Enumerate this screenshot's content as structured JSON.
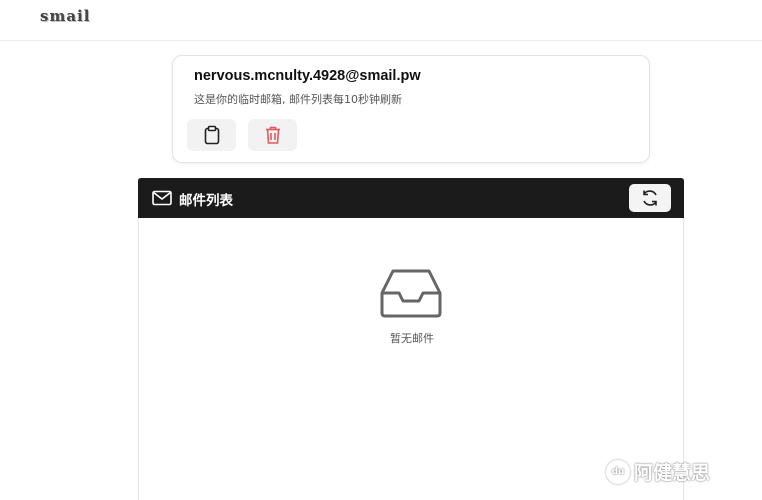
{
  "app": {
    "logo": "smail"
  },
  "email_card": {
    "address": "nervous.mcnulty.4928@smail.pw",
    "note": "这是你的临时邮箱, 邮件列表每10秒钟刷新",
    "copy_icon": "clipboard-icon",
    "delete_icon": "trash-icon",
    "delete_color": "#e05a5a"
  },
  "mail_list": {
    "title": "邮件列表",
    "header_bg": "#1b1b1b",
    "refresh_icon": "refresh-icon",
    "empty_text": "暂无邮件"
  },
  "watermark": {
    "text": "阿健慧思",
    "logo_text": "du"
  }
}
